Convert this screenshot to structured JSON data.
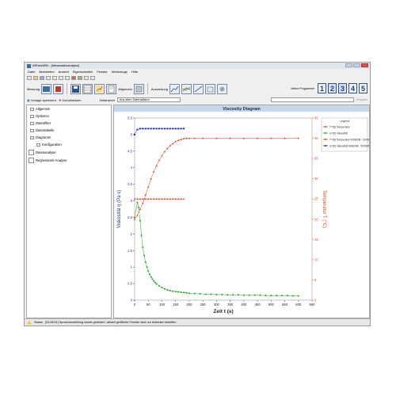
{
  "window": {
    "title": "ARheoWIN - [Messdatenanalyse]"
  },
  "menu": [
    "Datei",
    "Bearbeiten",
    "Ansicht",
    "Eigenschaften",
    "Fenster",
    "Werkzeuge",
    "Hilfe"
  ],
  "toolbar": {
    "messung_label": "Messung",
    "allgemein_label": "Allgemein",
    "auswertung_label": "Auswertung"
  },
  "programs": {
    "label": "Meine Programme",
    "buttons": [
      "1",
      "2",
      "3",
      "4",
      "5"
    ]
  },
  "actions": {
    "save_template": "Vorlage speichern",
    "reset": "Zurücksetzen",
    "zeitansicht_label": "Zeitansicht",
    "select_value": "Aus allen Datensätzen",
    "disabled_hint": "Eingabe"
  },
  "tree": {
    "items": [
      "Allgemein",
      "Optionen",
      "Datenfilter",
      "Datentabelle",
      "Diagramm",
      "Konfiguration"
    ],
    "docs": [
      "Datenanalyse",
      "Regressions-Analyse"
    ]
  },
  "status": {
    "label": "Status",
    "message": "[15:28:51] Sprachumstellung wurde geändert, aktuell geöffnete Fenster sind nur teilweise betroffen"
  },
  "chart_data": {
    "type": "scatter",
    "title": "Viscosity Diagram",
    "xlabel": "Zeit t (s)",
    "ylabel": "Viskosität η (Pa s)",
    "y2label": "Temperatur T (°C)",
    "xlim": [
      0,
      650
    ],
    "ylim": [
      0,
      5.5
    ],
    "y2lim": [
      0,
      45
    ],
    "xticks": [
      0,
      50,
      100,
      150,
      200,
      250,
      300,
      350,
      400,
      450,
      500,
      550,
      600,
      650
    ],
    "yticks": [
      0,
      0.5,
      1,
      1.5,
      2,
      2.5,
      3,
      3.5,
      4,
      4.5,
      5,
      5.5
    ],
    "y2ticks": [
      0,
      5,
      10,
      15,
      20,
      25,
      30,
      35,
      40,
      45
    ],
    "legend": {
      "title": "Legend",
      "position": "right",
      "entries": [
        "T=f(t) Temperatur",
        "η=f(t) Viskosität",
        "T=f(t) Temperatur 0008208 - 520006",
        "η=f(t) Viskosität 0008208 - 520006"
      ]
    },
    "colors": {
      "temp": "#d9452a",
      "visc": "#1aa61a",
      "viscRef": "#1f2fb0",
      "tempRef": "#d9452a",
      "axisLeft": "#1f2f8c",
      "axisRight": "#d9452a"
    },
    "series": [
      {
        "name": "T=f(t) Temperatur",
        "axis": "right",
        "color": "#d9452a",
        "x": [
          0,
          10,
          20,
          30,
          40,
          50,
          60,
          70,
          80,
          90,
          100,
          110,
          120,
          130,
          140,
          150,
          160,
          170,
          180,
          190,
          200,
          220,
          250,
          300,
          350,
          400,
          450,
          500,
          550,
          600
        ],
        "y": [
          20,
          21,
          22.5,
          24,
          26,
          28,
          30,
          31.7,
          33.2,
          34.6,
          35.7,
          36.7,
          37.5,
          38.2,
          38.7,
          39.2,
          39.5,
          39.7,
          39.9,
          40,
          40,
          40,
          40,
          40,
          40,
          40,
          40,
          40,
          40,
          40
        ]
      },
      {
        "name": "T=f(t) Temperatur 0008208 - 520006",
        "axis": "right",
        "color": "#d9452a",
        "x": [
          0,
          10,
          20,
          30,
          40,
          50,
          60,
          70,
          80,
          90,
          100,
          110,
          120,
          130,
          140,
          150,
          160,
          170,
          180
        ],
        "y": [
          25,
          25,
          25,
          25,
          25,
          25,
          25,
          25,
          25,
          25,
          25,
          25,
          25,
          25,
          25,
          25,
          25,
          25,
          25
        ]
      },
      {
        "name": "η=f(t) Viskosität 0008208 - 520006",
        "axis": "left",
        "color": "#1f2fb0",
        "x": [
          0,
          10,
          20,
          30,
          40,
          50,
          60,
          70,
          80,
          90,
          100,
          110,
          120,
          130,
          140,
          150,
          160,
          170,
          180
        ],
        "y": [
          5,
          5.15,
          5.18,
          5.18,
          5.18,
          5.18,
          5.18,
          5.18,
          5.18,
          5.18,
          5.18,
          5.18,
          5.18,
          5.18,
          5.18,
          5.18,
          5.18,
          5.18,
          5.18
        ]
      },
      {
        "name": "η=f(t) Viskosität",
        "axis": "left",
        "color": "#1aa61a",
        "x": [
          0,
          10,
          15,
          20,
          25,
          30,
          35,
          40,
          45,
          50,
          55,
          60,
          65,
          70,
          75,
          80,
          90,
          100,
          110,
          120,
          130,
          140,
          150,
          160,
          170,
          180,
          190,
          200,
          220,
          240,
          260,
          280,
          300,
          320,
          340,
          360,
          380,
          400,
          420,
          440,
          460,
          480,
          500,
          520,
          540,
          560,
          580,
          600
        ],
        "y": [
          2.5,
          2.95,
          2.8,
          2.4,
          1.95,
          1.6,
          1.35,
          1.15,
          1.0,
          0.88,
          0.78,
          0.7,
          0.64,
          0.58,
          0.53,
          0.49,
          0.43,
          0.38,
          0.34,
          0.31,
          0.29,
          0.27,
          0.26,
          0.25,
          0.24,
          0.23,
          0.22,
          0.21,
          0.2,
          0.19,
          0.18,
          0.18,
          0.17,
          0.17,
          0.16,
          0.16,
          0.16,
          0.15,
          0.15,
          0.15,
          0.15,
          0.14,
          0.14,
          0.14,
          0.14,
          0.14,
          0.13,
          0.13
        ]
      }
    ]
  }
}
